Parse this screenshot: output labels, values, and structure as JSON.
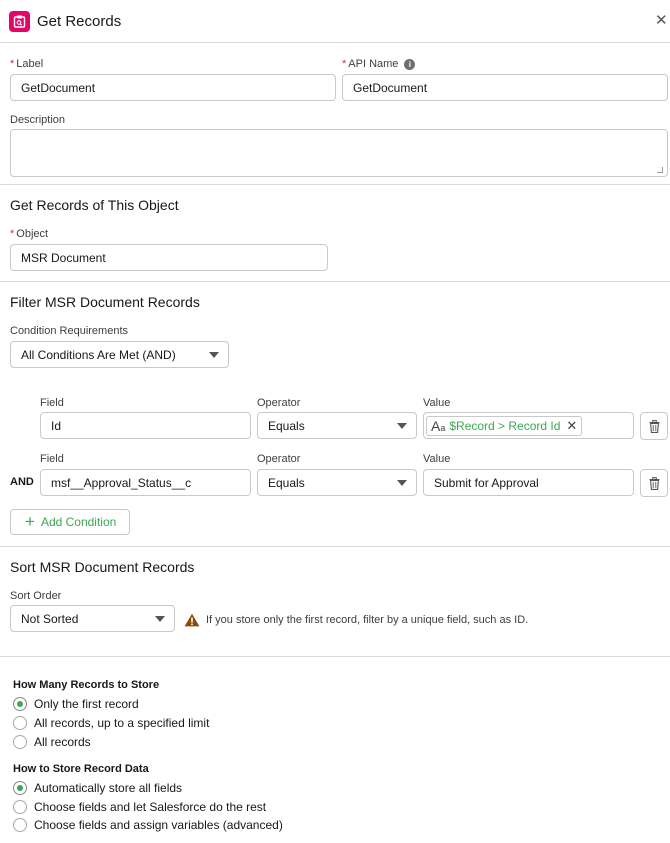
{
  "header": {
    "title": "Get Records",
    "close_glyph": "✕",
    "icon": "get-records-icon",
    "accent": "#e3066a"
  },
  "general": {
    "label": {
      "label": "Label",
      "value": "GetDocument"
    },
    "api_name": {
      "label": "API Name",
      "value": "GetDocument"
    },
    "description": {
      "label": "Description",
      "value": ""
    }
  },
  "object_section": {
    "title": "Get Records of This Object",
    "object": {
      "label": "Object",
      "value": "MSR Document"
    }
  },
  "filter_section": {
    "title": "Filter MSR Document Records",
    "condition_requirements": {
      "label": "Condition Requirements",
      "value": "All Conditions Are Met (AND)"
    },
    "conditions": [
      {
        "prefix": "",
        "field_label": "Field",
        "field": "Id",
        "operator_label": "Operator",
        "operator": "Equals",
        "value_label": "Value",
        "value": "$Record > Record Id"
      },
      {
        "prefix": "AND",
        "field_label": "Field",
        "field": "msf__Approval_Status__c",
        "operator_label": "Operator",
        "operator": "Equals",
        "value_label": "Value",
        "value": "Submit for Approval"
      }
    ],
    "add_condition": "Add Condition"
  },
  "sort_section": {
    "title": "Sort MSR Document Records",
    "sort_order": {
      "label": "Sort Order",
      "value": "Not Sorted"
    },
    "hint": "If you store only the first record, filter by a unique field, such as ID."
  },
  "store_count": {
    "title": "How Many Records to Store",
    "options": [
      "Only the first record",
      "All records, up to a specified limit",
      "All records"
    ],
    "selected": 0
  },
  "store_data": {
    "title": "How to Store Record Data",
    "options": [
      "Automatically store all fields",
      "Choose fields and let Salesforce do the rest",
      "Choose fields and assign variables (advanced)"
    ],
    "selected": 0
  },
  "colors": {
    "accent_green": "#3ba755",
    "required_red": "#c23934",
    "warning": "#8c4b02"
  }
}
